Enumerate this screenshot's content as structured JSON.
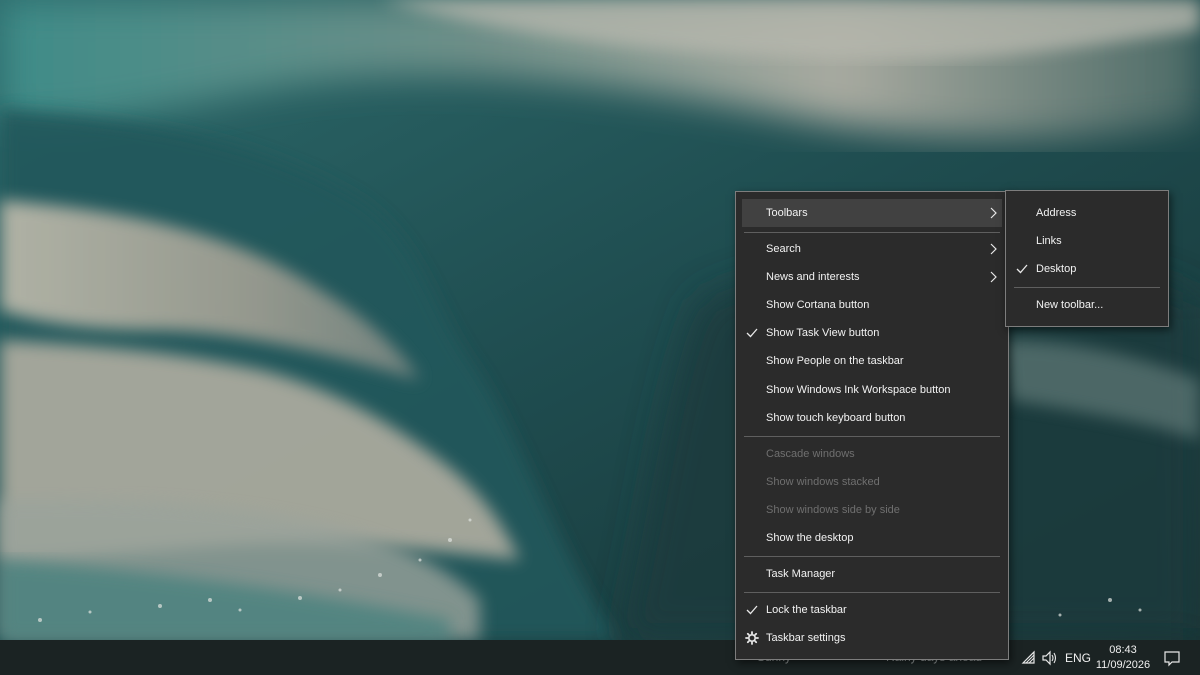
{
  "context_menu": {
    "items": [
      {
        "label": "Toolbars",
        "submenu": true
      },
      {
        "label": "Search",
        "submenu": true
      },
      {
        "label": "News and interests",
        "submenu": true
      },
      {
        "label": "Show Cortana button"
      },
      {
        "label": "Show Task View button",
        "checked": true
      },
      {
        "label": "Show People on the taskbar"
      },
      {
        "label": "Show Windows Ink Workspace button"
      },
      {
        "label": "Show touch keyboard button"
      },
      {
        "label": "Cascade windows",
        "disabled": true
      },
      {
        "label": "Show windows stacked",
        "disabled": true
      },
      {
        "label": "Show windows side by side",
        "disabled": true
      },
      {
        "label": "Show the desktop"
      },
      {
        "label": "Task Manager"
      },
      {
        "label": "Lock the taskbar",
        "checked": true
      },
      {
        "label": "Taskbar settings",
        "icon": "gear-icon"
      }
    ]
  },
  "toolbars_submenu": {
    "items": [
      {
        "label": "Address"
      },
      {
        "label": "Links"
      },
      {
        "label": "Desktop",
        "checked": true
      },
      {
        "label": "New toolbar..."
      }
    ]
  },
  "taskbar": {
    "obscured_left": "Sunny",
    "obscured_weather": "Rainy days ahead",
    "language": "ENG",
    "time": "08:43",
    "date": "11/09/2026",
    "tray_icons": [
      "network-icon",
      "volume-icon",
      "notification-icon"
    ]
  },
  "colors": {
    "menu_bg": "#2b2b2b",
    "menu_border": "#7d7d7d",
    "highlight": "#414141",
    "taskbar_bg": "#1b2323",
    "disabled_text": "#6f6f6f"
  }
}
